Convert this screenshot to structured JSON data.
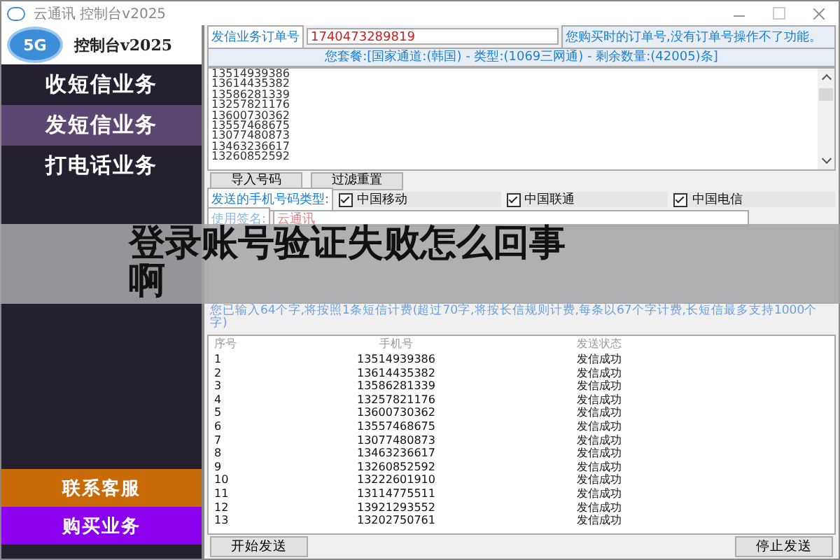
{
  "window": {
    "title": "云通讯 控制台v2025"
  },
  "sidebar": {
    "logo_badge": "5G",
    "logo_title": "控制台v2025",
    "items": [
      {
        "label": "收短信业务",
        "selected": false
      },
      {
        "label": "发短信业务",
        "selected": true
      },
      {
        "label": "打电话业务",
        "selected": false
      }
    ],
    "footer_items": [
      {
        "label": "联系客服",
        "color": "#c86a08"
      },
      {
        "label": "购买业务",
        "color": "#8c00f0"
      }
    ]
  },
  "order": {
    "label": "发信业务订单号",
    "value": "1740473289819",
    "hint": "您购买时的订单号,没有订单号操作不了功能。"
  },
  "package": "您套餐:[国家通道:(韩国) - 类型:(1069三网通) - 剩余数量:(42005)条]",
  "numbers": [
    "13514939386",
    "13614435382",
    "13586281339",
    "13257821176",
    "13600730362",
    "13557468675",
    "13077480873",
    "13463236617",
    "13260852592"
  ],
  "number_buttons": [
    "导入号码",
    "过滤重置"
  ],
  "carrier_label": "发送的手机号码类型:",
  "carriers": [
    {
      "label": "中国移动",
      "checked": true
    },
    {
      "label": "中国联通",
      "checked": true
    },
    {
      "label": "中国电信",
      "checked": true
    }
  ],
  "signature": {
    "label": "使用签名:",
    "value": "云通讯"
  },
  "count_hint": "您已输入64个字,将按照1条短信计费(超过70字,将按长信规则计费,每条以67个字计费,长短信最多支持1000个字)",
  "table": {
    "columns": [
      "序号",
      "手机号",
      "发送状态"
    ],
    "rows": [
      [
        "1",
        "13514939386",
        "发信成功"
      ],
      [
        "2",
        "13614435382",
        "发信成功"
      ],
      [
        "3",
        "13586281339",
        "发信成功"
      ],
      [
        "4",
        "13257821176",
        "发信成功"
      ],
      [
        "5",
        "13600730362",
        "发信成功"
      ],
      [
        "6",
        "13557468675",
        "发信成功"
      ],
      [
        "7",
        "13077480873",
        "发信成功"
      ],
      [
        "8",
        "13463236617",
        "发信成功"
      ],
      [
        "9",
        "13260852592",
        "发信成功"
      ],
      [
        "10",
        "13222601910",
        "发信成功"
      ],
      [
        "11",
        "13114775511",
        "发信成功"
      ],
      [
        "12",
        "13921293552",
        "发信成功"
      ],
      [
        "13",
        "13202750761",
        "发信成功"
      ]
    ]
  },
  "actions": [
    "开始发送",
    "停止发送"
  ],
  "overlay_title": "登录账号验证失败怎么回事啊"
}
